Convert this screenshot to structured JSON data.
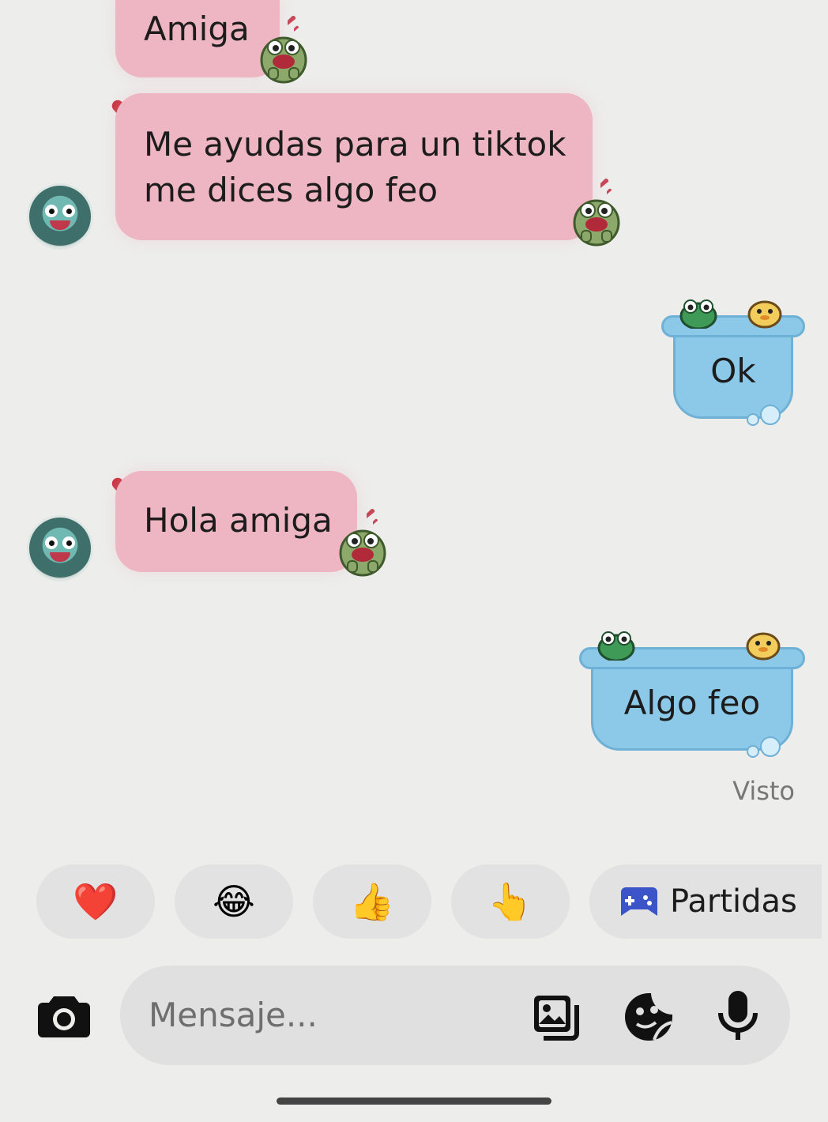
{
  "messages": [
    {
      "id": "m1",
      "direction": "incoming",
      "text": "Amiga"
    },
    {
      "id": "m2",
      "direction": "incoming",
      "line1": "Me ayudas para un tiktok",
      "line2": "me dices algo feo"
    },
    {
      "id": "m3",
      "direction": "outgoing",
      "text": "Ok"
    },
    {
      "id": "m4",
      "direction": "incoming",
      "text": "Hola amiga"
    },
    {
      "id": "m5",
      "direction": "outgoing",
      "text": "Algo feo"
    }
  ],
  "status": {
    "seen": "Visto"
  },
  "quick_reactions": [
    {
      "icon": "red-heart-emoji",
      "glyph": "❤️"
    },
    {
      "icon": "laughing-tears-emoji",
      "glyph": "😂"
    },
    {
      "icon": "thumbs-up-emoji",
      "glyph": "👍"
    },
    {
      "icon": "pointing-hand-emoji",
      "glyph": "👆"
    }
  ],
  "games_chip": {
    "icon": "gamepad-icon",
    "label": "Partidas"
  },
  "composer": {
    "placeholder": "Mensaje...",
    "icons": [
      "camera-icon",
      "gallery-icon",
      "sticker-icon",
      "microphone-icon"
    ]
  },
  "colors": {
    "incoming_bubble": "#eeb6c3",
    "outgoing_bubble": "#8cc9e8",
    "background": "#ededec",
    "games_icon": "#3b55c8"
  }
}
